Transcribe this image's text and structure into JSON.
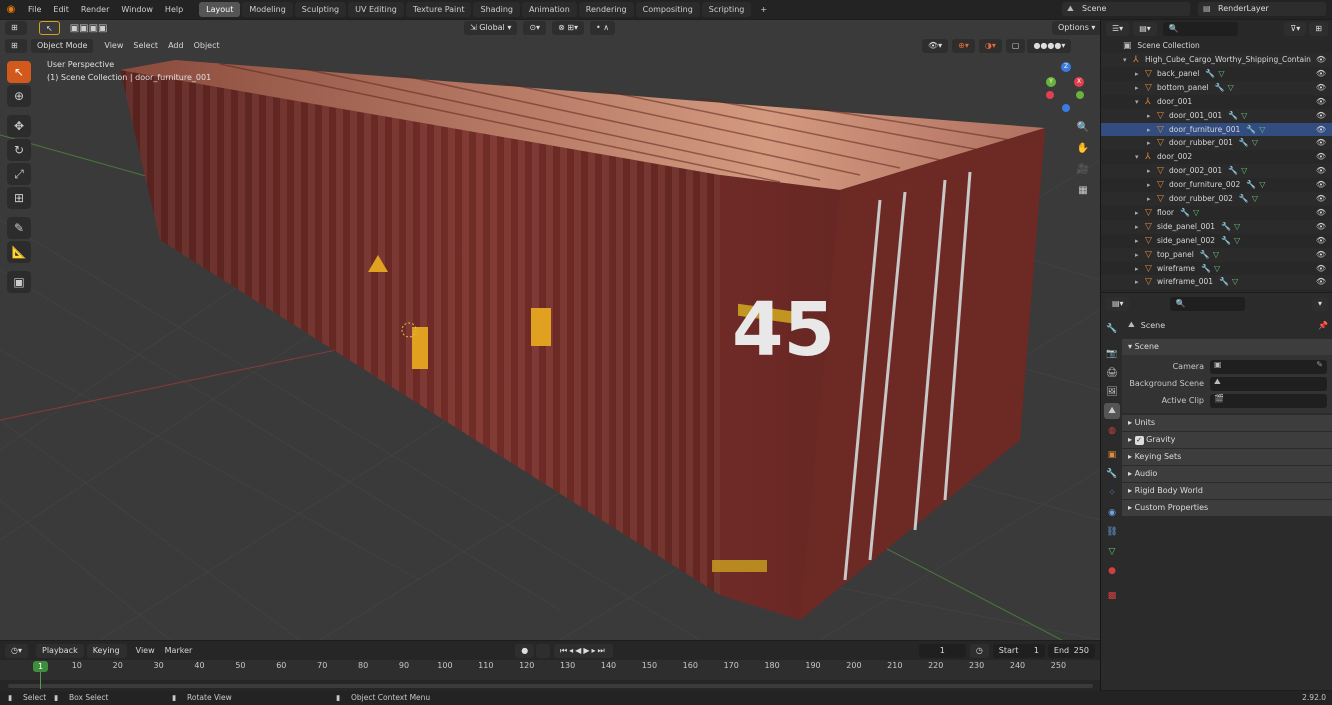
{
  "topbar": {
    "menus": [
      "File",
      "Edit",
      "Render",
      "Window",
      "Help"
    ],
    "workspaces": [
      "Layout",
      "Modeling",
      "Sculpting",
      "UV Editing",
      "Texture Paint",
      "Shading",
      "Animation",
      "Rendering",
      "Compositing",
      "Scripting"
    ],
    "active_workspace": "Layout",
    "add_tab": "+",
    "scene_name": "Scene",
    "view_layer": "RenderLayer"
  },
  "viewport": {
    "mode": "Object Mode",
    "menus": [
      "View",
      "Select",
      "Add",
      "Object"
    ],
    "orientation": "Global",
    "options": "Options",
    "view_name": "User Perspective",
    "collection_info": "(1) Scene Collection | door_furniture_001",
    "container_number": "45",
    "gizmo": {
      "x": "X",
      "y": "Y",
      "z": "Z"
    }
  },
  "outliner": {
    "search_placeholder": "",
    "root": "Scene Collection",
    "items": [
      {
        "label": "High_Cube_Cargo_Worthy_Shipping_Contain",
        "level": 1,
        "expanded": true,
        "icon": "object-icon"
      },
      {
        "label": "back_panel",
        "level": 2,
        "expanded": false,
        "icon": "mesh-object-icon"
      },
      {
        "label": "bottom_panel",
        "level": 2,
        "expanded": false,
        "icon": "mesh-object-icon"
      },
      {
        "label": "door_001",
        "level": 2,
        "expanded": true,
        "icon": "empty-icon"
      },
      {
        "label": "door_001_001",
        "level": 3,
        "expanded": false,
        "icon": "mesh-object-icon"
      },
      {
        "label": "door_furniture_001",
        "level": 3,
        "expanded": false,
        "icon": "mesh-object-icon",
        "selected": true
      },
      {
        "label": "door_rubber_001",
        "level": 3,
        "expanded": false,
        "icon": "mesh-object-icon"
      },
      {
        "label": "door_002",
        "level": 2,
        "expanded": true,
        "icon": "empty-icon"
      },
      {
        "label": "door_002_001",
        "level": 3,
        "expanded": false,
        "icon": "mesh-object-icon"
      },
      {
        "label": "door_furniture_002",
        "level": 3,
        "expanded": false,
        "icon": "mesh-object-icon"
      },
      {
        "label": "door_rubber_002",
        "level": 3,
        "expanded": false,
        "icon": "mesh-object-icon"
      },
      {
        "label": "floor",
        "level": 2,
        "expanded": false,
        "icon": "mesh-object-icon"
      },
      {
        "label": "side_panel_001",
        "level": 2,
        "expanded": false,
        "icon": "mesh-object-icon"
      },
      {
        "label": "side_panel_002",
        "level": 2,
        "expanded": false,
        "icon": "mesh-object-icon"
      },
      {
        "label": "top_panel",
        "level": 2,
        "expanded": false,
        "icon": "mesh-object-icon"
      },
      {
        "label": "wireframe",
        "level": 2,
        "expanded": false,
        "icon": "mesh-object-icon"
      },
      {
        "label": "wireframe_001",
        "level": 2,
        "expanded": false,
        "icon": "mesh-object-icon"
      }
    ]
  },
  "properties": {
    "context": "Scene",
    "panel_scene": "Scene",
    "fields": [
      {
        "label": "Camera",
        "value": ""
      },
      {
        "label": "Background Scene",
        "value": ""
      },
      {
        "label": "Active Clip",
        "value": ""
      }
    ],
    "subpanels": [
      "Units",
      "Gravity",
      "Keying Sets",
      "Audio",
      "Rigid Body World",
      "Custom Properties"
    ],
    "gravity_checked": true
  },
  "timeline": {
    "menus": [
      "Playback",
      "Keying",
      "View",
      "Marker"
    ],
    "current_frame": "1",
    "start_label": "Start",
    "start_value": "1",
    "end_label": "End",
    "end_value": "250",
    "frame_marker": "1",
    "ruler": [
      "10",
      "20",
      "30",
      "40",
      "50",
      "60",
      "70",
      "80",
      "90",
      "100",
      "110",
      "120",
      "130",
      "140",
      "150",
      "160",
      "170",
      "180",
      "190",
      "200",
      "210",
      "220",
      "230",
      "240",
      "250"
    ]
  },
  "statusbar": {
    "items": [
      "Select",
      "Box Select",
      "Rotate View",
      "Object Context Menu"
    ],
    "version": "2.92.0"
  },
  "colors": {
    "accent": "#d3581c",
    "selection": "#334d80",
    "container": "#7a2e28"
  }
}
